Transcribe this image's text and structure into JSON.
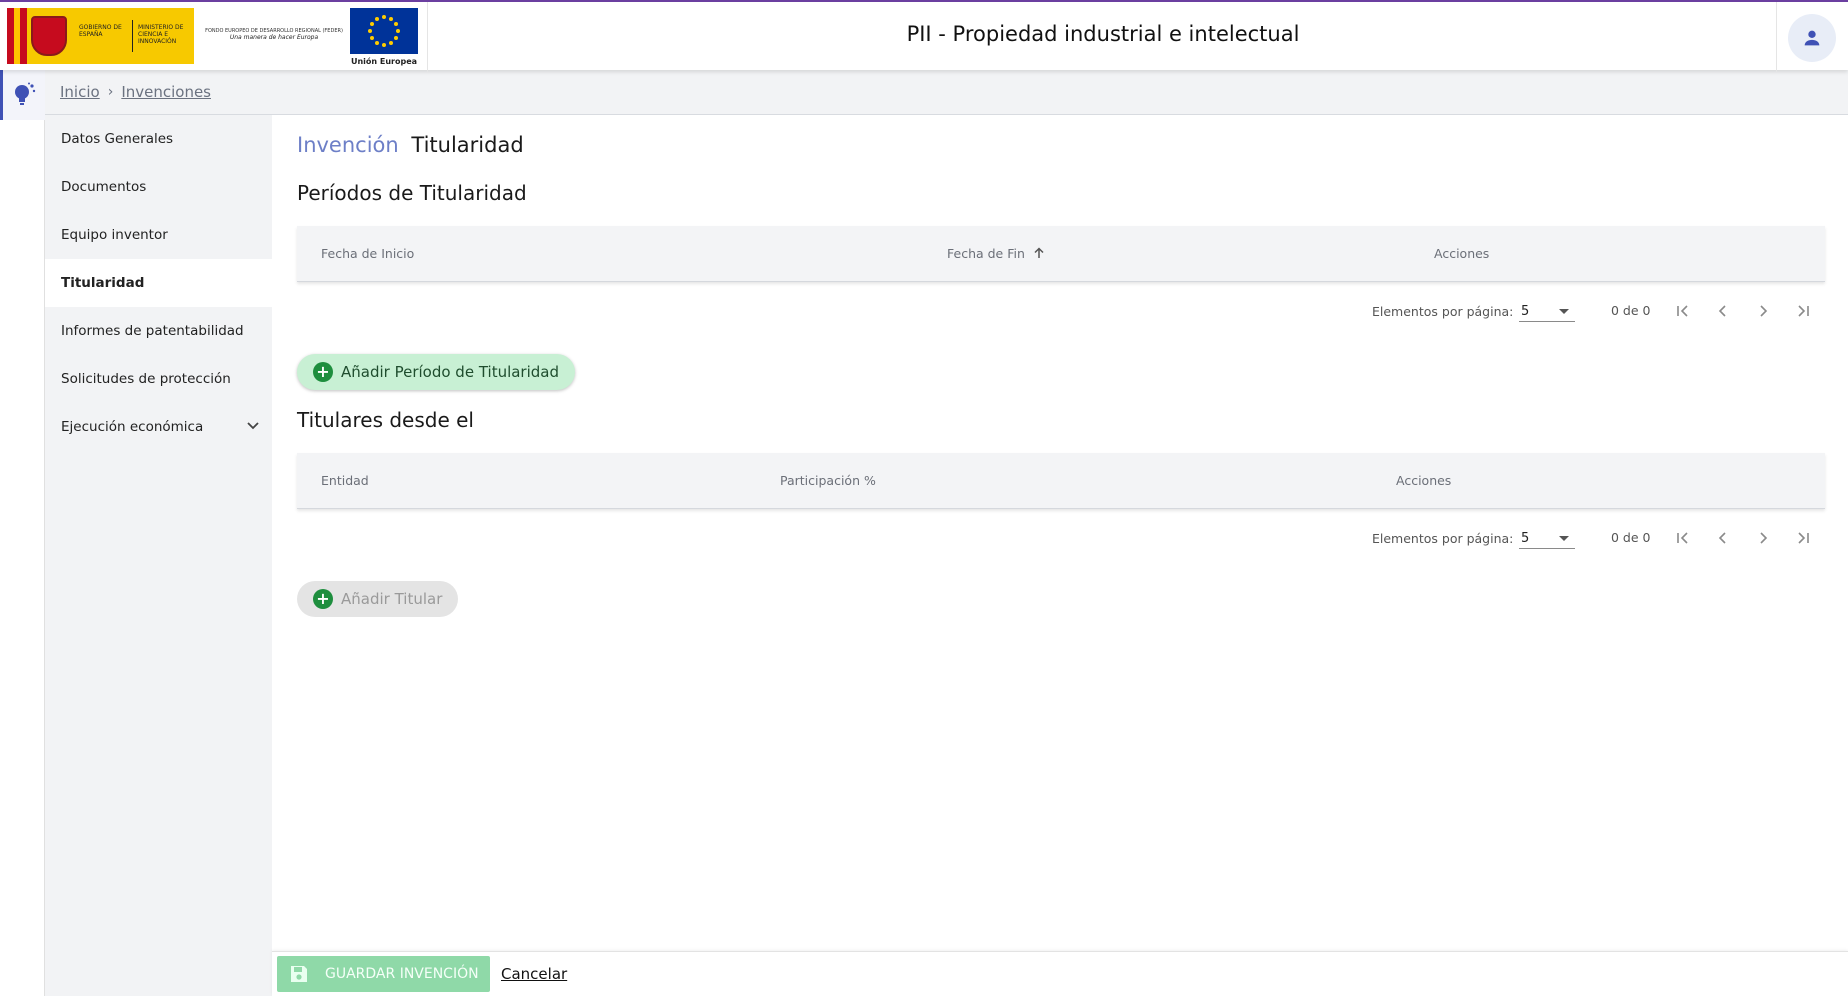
{
  "header": {
    "gob_line1": "GOBIERNO DE ESPAÑA",
    "gob_line2": "MINISTERIO DE CIENCIA E INNOVACIÓN",
    "feder_line1": "FONDO EUROPEO DE DESARROLLO REGIONAL (FEDER)",
    "feder_line2": "Una manera de hacer Europa",
    "eu_label": "Unión Europea",
    "title": "PII - Propiedad industrial e intelectual",
    "user_icon": "person-icon"
  },
  "breadcrumb": {
    "home": "Inicio",
    "current": "Invenciones"
  },
  "sidebar": {
    "items": [
      {
        "label": "Datos Generales"
      },
      {
        "label": "Documentos"
      },
      {
        "label": "Equipo inventor"
      },
      {
        "label": "Titularidad"
      },
      {
        "label": "Informes de patentabilidad"
      },
      {
        "label": "Solicitudes de protección"
      },
      {
        "label": "Ejecución económica"
      }
    ],
    "active": "Titularidad"
  },
  "main": {
    "title_prefix": "Invención",
    "title": "Titularidad",
    "periods": {
      "section_title": "Períodos de Titularidad",
      "columns": [
        "Fecha de Inicio",
        "Fecha de Fin",
        "Acciones"
      ],
      "sort_column": "Fecha de Fin",
      "page_size_label": "Elementos por página:",
      "page_size": "5",
      "range": "0 de 0",
      "add_label": "Añadir Período de Titularidad"
    },
    "holders": {
      "section_title": "Titulares desde el",
      "columns": [
        "Entidad",
        "Participación %",
        "Acciones"
      ],
      "page_size_label": "Elementos por página:",
      "page_size": "5",
      "range": "0 de 0",
      "add_label": "Añadir Titular"
    }
  },
  "footer": {
    "save_label": "GUARDAR INVENCIÓN",
    "cancel_label": "Cancelar"
  },
  "colors": {
    "accent": "#6d7fc7",
    "add_enabled_bg": "#c8f0d4",
    "save_bg": "#8fd9a8",
    "plus_green": "#1e8e3e"
  }
}
